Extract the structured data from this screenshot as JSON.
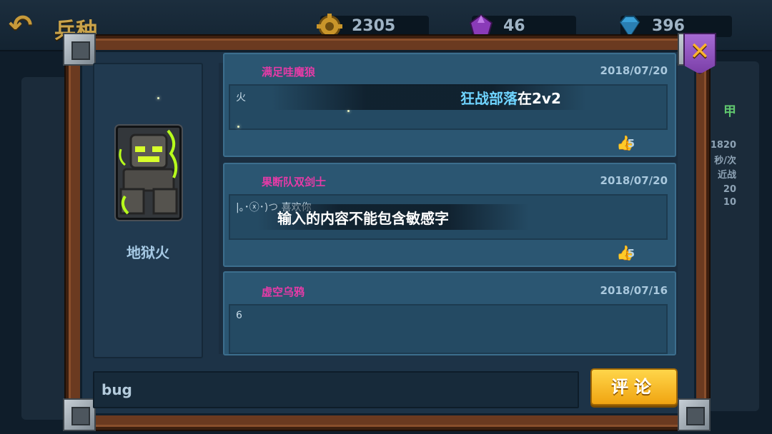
{
  "header": {
    "back_icon": "back-arrow-icon",
    "title": "兵种",
    "currencies": [
      {
        "icon": "gear-coin-icon",
        "value": "2305"
      },
      {
        "icon": "purple-crystal-icon",
        "value": "46"
      },
      {
        "icon": "diamond-icon",
        "value": "396"
      }
    ]
  },
  "background_stats": {
    "heading_fragment": "甲",
    "lines": [
      "1820",
      "秒/次",
      "近战",
      "20",
      "10"
    ]
  },
  "unit": {
    "name": "地狱火"
  },
  "comments": [
    {
      "user": "满足哇魔狼",
      "date": "2018/07/20",
      "text": "火",
      "likes": "5"
    },
    {
      "user": "果断队双剑士",
      "date": "2018/07/20",
      "text": "|｡･ⓧ･)つ   喜欢你",
      "likes": "5"
    },
    {
      "user": "虚空乌鸦",
      "date": "2018/07/16",
      "text": "6",
      "likes": ""
    }
  ],
  "toasts": {
    "first_highlight": "狂战部落",
    "first_rest": "在2v2",
    "second": "输入的内容不能包含敏感字"
  },
  "input": {
    "value": "bug"
  },
  "buttons": {
    "submit_label": "评论",
    "close_icon": "close-x-icon"
  }
}
